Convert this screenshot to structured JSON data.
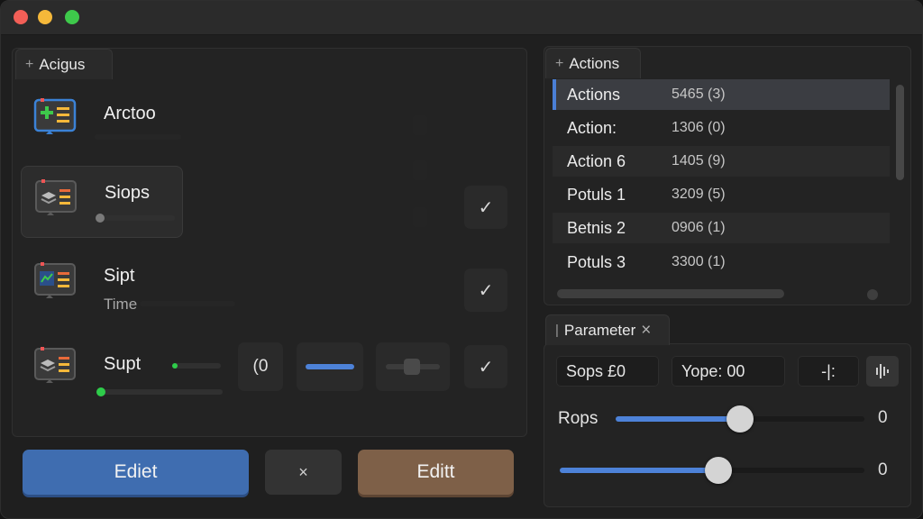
{
  "window": {
    "controls": [
      "close",
      "minimize",
      "maximize"
    ]
  },
  "left_panel": {
    "tab_label": "Acigus",
    "items": [
      {
        "title": "Arctoo",
        "icon": "add-list-icon"
      },
      {
        "title": "Siops",
        "icon": "layers-list-icon",
        "progress": 0.0
      },
      {
        "title": "Sipt",
        "subtitle": "Time",
        "icon": "chart-list-icon"
      },
      {
        "title": "Supt",
        "icon": "layers-list-icon",
        "progress": 0.0
      }
    ],
    "controls": {
      "counter_value": "(0"
    },
    "buttons": {
      "primary_label": "Ediet",
      "cancel_label": "×",
      "edit_label": "Editt"
    }
  },
  "actions_panel": {
    "tab_label": "Actions",
    "rows": [
      {
        "name": "Actions",
        "value": "5465 (3)"
      },
      {
        "name": "Action:",
        "value": "1306 (0)"
      },
      {
        "name": "Action 6",
        "value": "1405 (9)"
      },
      {
        "name": "Potuls 1",
        "value": "3209 (5)"
      },
      {
        "name": "Betnis 2",
        "value": "0906 (1)"
      },
      {
        "name": "Potuls 3",
        "value": "3300 (1)"
      }
    ]
  },
  "parameter_panel": {
    "tab_label": "Parameter",
    "close_label": "×",
    "field_sops": "Sops £0",
    "field_yope": "Yope: 00",
    "field_mini": "-|:",
    "sliders": [
      {
        "label": "Rops",
        "value": "0",
        "level": 0.5
      },
      {
        "label": "",
        "value": "0",
        "level": 0.52
      }
    ]
  },
  "colors": {
    "accent": "#4d82d8",
    "primary_button": "#3f6db0",
    "edit_button": "#7e6048",
    "progress_green": "#2ecc4a"
  }
}
